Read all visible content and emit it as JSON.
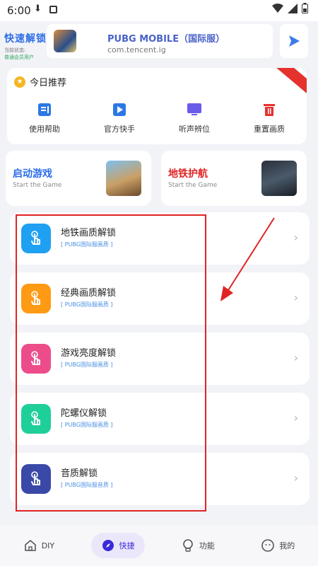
{
  "status": {
    "time": "6:00"
  },
  "topbar": {
    "brand_title": "快速解锁",
    "brand_sub1": "当前状态:",
    "brand_sub2": "普通会员用户",
    "app_name": "PUBG MOBILE（国际服）",
    "app_pkg": "com.tencent.ig"
  },
  "recommend": {
    "title": "今日推荐",
    "items": [
      {
        "label": "使用帮助",
        "icon": "help-icon"
      },
      {
        "label": "官方快手",
        "icon": "video-icon"
      },
      {
        "label": "听声辨位",
        "icon": "monitor-icon"
      },
      {
        "label": "重置画质",
        "icon": "trash-icon"
      }
    ]
  },
  "games": [
    {
      "title": "启动游戏",
      "sub": "Start the Game",
      "color": "#2b6de8"
    },
    {
      "title": "地铁护航",
      "sub": "Start the Game",
      "color": "#e02424"
    }
  ],
  "unlock_rows": [
    {
      "title": "地铁画质解锁",
      "tag": "[ PUBG国际服画质 ]",
      "color": "#1fa0f2"
    },
    {
      "title": "经典画质解锁",
      "tag": "[ PUBG国际服画质 ]",
      "color": "#ff9a14"
    },
    {
      "title": "游戏亮度解锁",
      "tag": "[ PUBG国际服画质 ]",
      "color": "#ec4d8a"
    },
    {
      "title": "陀螺仪解锁",
      "tag": "[ PUBG国际服画质 ]",
      "color": "#1fcf9a"
    },
    {
      "title": "音质解锁",
      "tag": "[ PUBG国际服音质 ]",
      "color": "#3a48a8"
    }
  ],
  "nav": {
    "items": [
      {
        "label": "DIY",
        "icon": "home-icon"
      },
      {
        "label": "快捷",
        "icon": "compass-icon"
      },
      {
        "label": "功能",
        "icon": "bulb-icon"
      },
      {
        "label": "我的",
        "icon": "face-icon"
      }
    ]
  }
}
